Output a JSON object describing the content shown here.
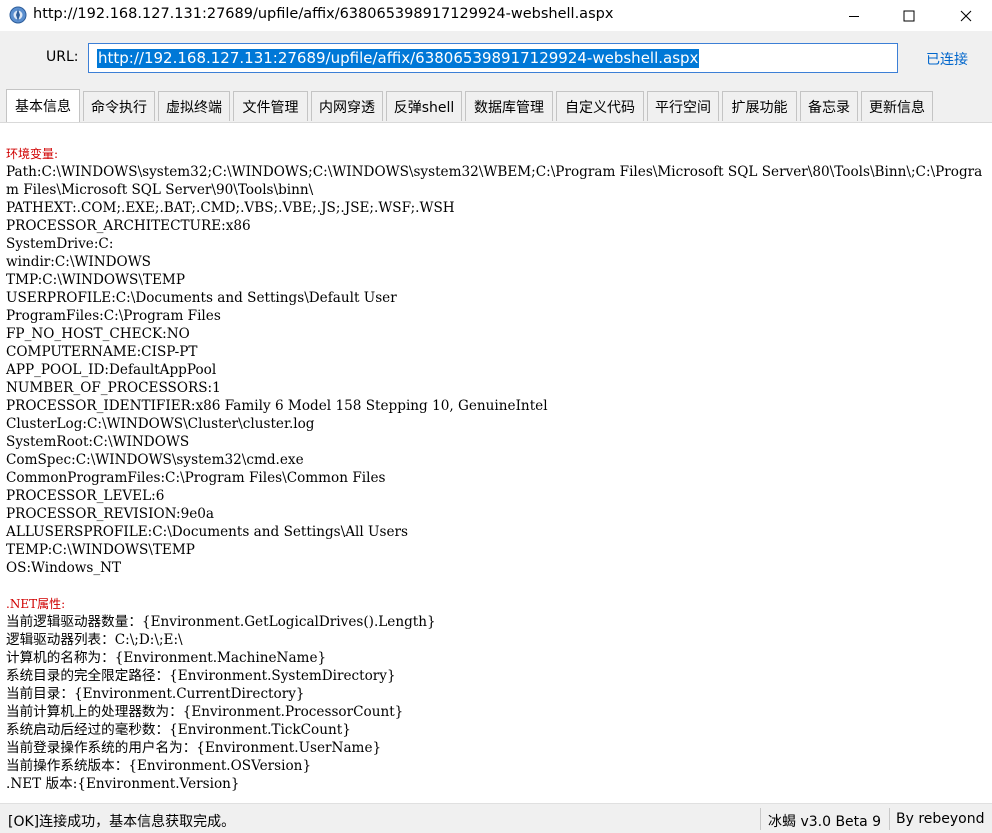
{
  "window": {
    "title": "http://192.168.127.131:27689/upfile/affix/638065398917129924-webshell.aspx",
    "controls": {
      "minimize": "minimize-icon",
      "maximize": "maximize-icon",
      "close": "close-icon"
    }
  },
  "urlbar": {
    "label": "URL:",
    "value": "http://192.168.127.131:27689/upfile/affix/638065398917129924-webshell.aspx",
    "status": "已连接"
  },
  "tabs": [
    {
      "label": "基本信息",
      "active": true
    },
    {
      "label": "命令执行",
      "active": false
    },
    {
      "label": "虚拟终端",
      "active": false
    },
    {
      "label": "文件管理",
      "active": false
    },
    {
      "label": "内网穿透",
      "active": false
    },
    {
      "label": "反弹shell",
      "active": false
    },
    {
      "label": "数据库管理",
      "active": false
    },
    {
      "label": "自定义代码",
      "active": false
    },
    {
      "label": "平行空间",
      "active": false
    },
    {
      "label": "扩展功能",
      "active": false
    },
    {
      "label": "备忘录",
      "active": false
    },
    {
      "label": "更新信息",
      "active": false
    }
  ],
  "content": {
    "env_title": "环境变量:",
    "env_lines": [
      "Path:C:\\WINDOWS\\system32;C:\\WINDOWS;C:\\WINDOWS\\system32\\WBEM;C:\\Program Files\\Microsoft SQL Server\\80\\Tools\\Binn\\;C:\\Program Files\\Microsoft SQL Server\\90\\Tools\\binn\\",
      "PATHEXT:.COM;.EXE;.BAT;.CMD;.VBS;.VBE;.JS;.JSE;.WSF;.WSH",
      "PROCESSOR_ARCHITECTURE:x86",
      "SystemDrive:C:",
      "windir:C:\\WINDOWS",
      "TMP:C:\\WINDOWS\\TEMP",
      "USERPROFILE:C:\\Documents and Settings\\Default User",
      "ProgramFiles:C:\\Program Files",
      "FP_NO_HOST_CHECK:NO",
      "COMPUTERNAME:CISP-PT",
      "APP_POOL_ID:DefaultAppPool",
      "NUMBER_OF_PROCESSORS:1",
      "PROCESSOR_IDENTIFIER:x86 Family 6 Model 158 Stepping 10, GenuineIntel",
      "ClusterLog:C:\\WINDOWS\\Cluster\\cluster.log",
      "SystemRoot:C:\\WINDOWS",
      "ComSpec:C:\\WINDOWS\\system32\\cmd.exe",
      "CommonProgramFiles:C:\\Program Files\\Common Files",
      "PROCESSOR_LEVEL:6",
      "PROCESSOR_REVISION:9e0a",
      "ALLUSERSPROFILE:C:\\Documents and Settings\\All Users",
      "TEMP:C:\\WINDOWS\\TEMP",
      "OS:Windows_NT"
    ],
    "net_title": ".NET属性:",
    "net_lines": [
      "当前逻辑驱动器数量：{Environment.GetLogicalDrives().Length}",
      "逻辑驱动器列表：C:\\;D:\\;E:\\",
      "计算机的名称为：{Environment.MachineName}",
      "系统目录的完全限定路径：{Environment.SystemDirectory}",
      "当前目录：{Environment.CurrentDirectory}",
      "当前计算机上的处理器数为：{Environment.ProcessorCount}",
      "系统启动后经过的毫秒数：{Environment.TickCount}",
      "当前登录操作系统的用户名为：{Environment.UserName}",
      "当前操作系统版本：{Environment.OSVersion}",
      ".NET 版本:{Environment.Version}"
    ]
  },
  "statusbar": {
    "message": "[OK]连接成功，基本信息获取完成。",
    "version": "冰蝎 v3.0 Beta 9",
    "author": "By rebeyond"
  },
  "colors": {
    "accent": "#0078d7",
    "link": "#0066cc",
    "section_header": "#d00000"
  }
}
